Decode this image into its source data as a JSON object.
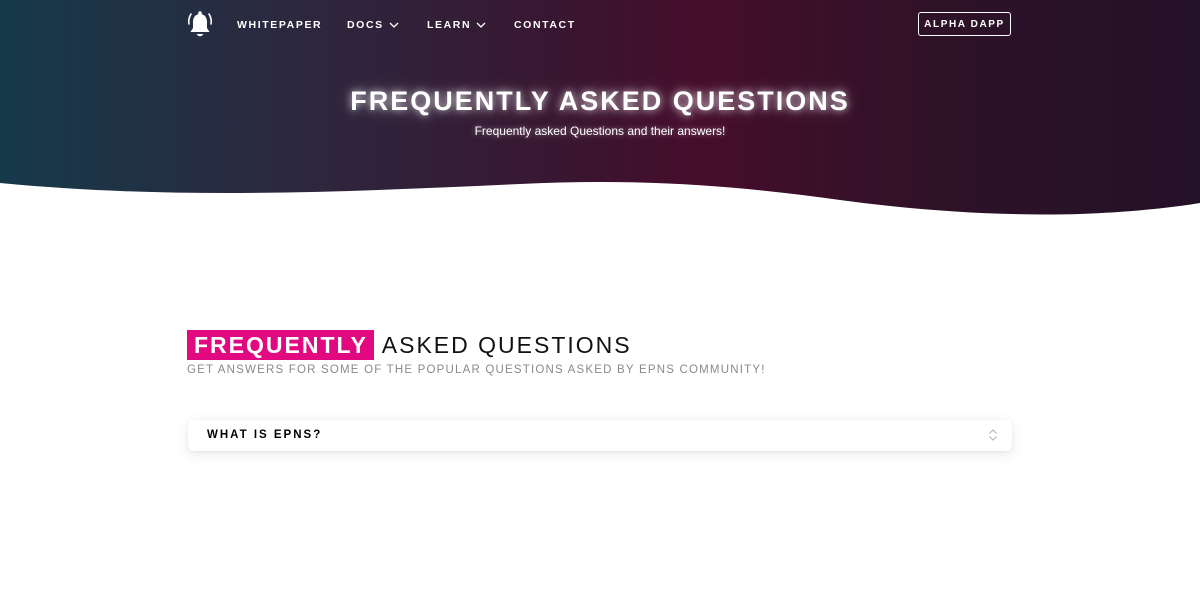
{
  "nav": {
    "items": [
      {
        "label": "WHITEPAPER",
        "dropdown": false
      },
      {
        "label": "DOCS",
        "dropdown": true
      },
      {
        "label": "LEARN",
        "dropdown": true
      },
      {
        "label": "CONTACT",
        "dropdown": false
      }
    ],
    "cta_label": "ALPHA DAPP"
  },
  "hero": {
    "title": "FREQUENTLY ASKED QUESTIONS",
    "subtitle": "Frequently asked Questions and their answers!"
  },
  "section": {
    "title_highlight": "FREQUENTLY",
    "title_rest": "ASKED QUESTIONS",
    "subtitle": "GET ANSWERS FOR SOME OF THE POPULAR QUESTIONS ASKED BY EPNS COMMUNITY!"
  },
  "faq": [
    {
      "question": "WHAT IS EPNS?",
      "expanded": false
    }
  ],
  "icons": {
    "logo": "bell-icon",
    "dropdown": "chevron-down-icon",
    "faq_toggle": "chevron-up-down-icon"
  },
  "colors": {
    "accent": "#e20880",
    "hero_left": "#16394a",
    "hero_mid": "#450d2c",
    "hero_right": "#231127"
  }
}
